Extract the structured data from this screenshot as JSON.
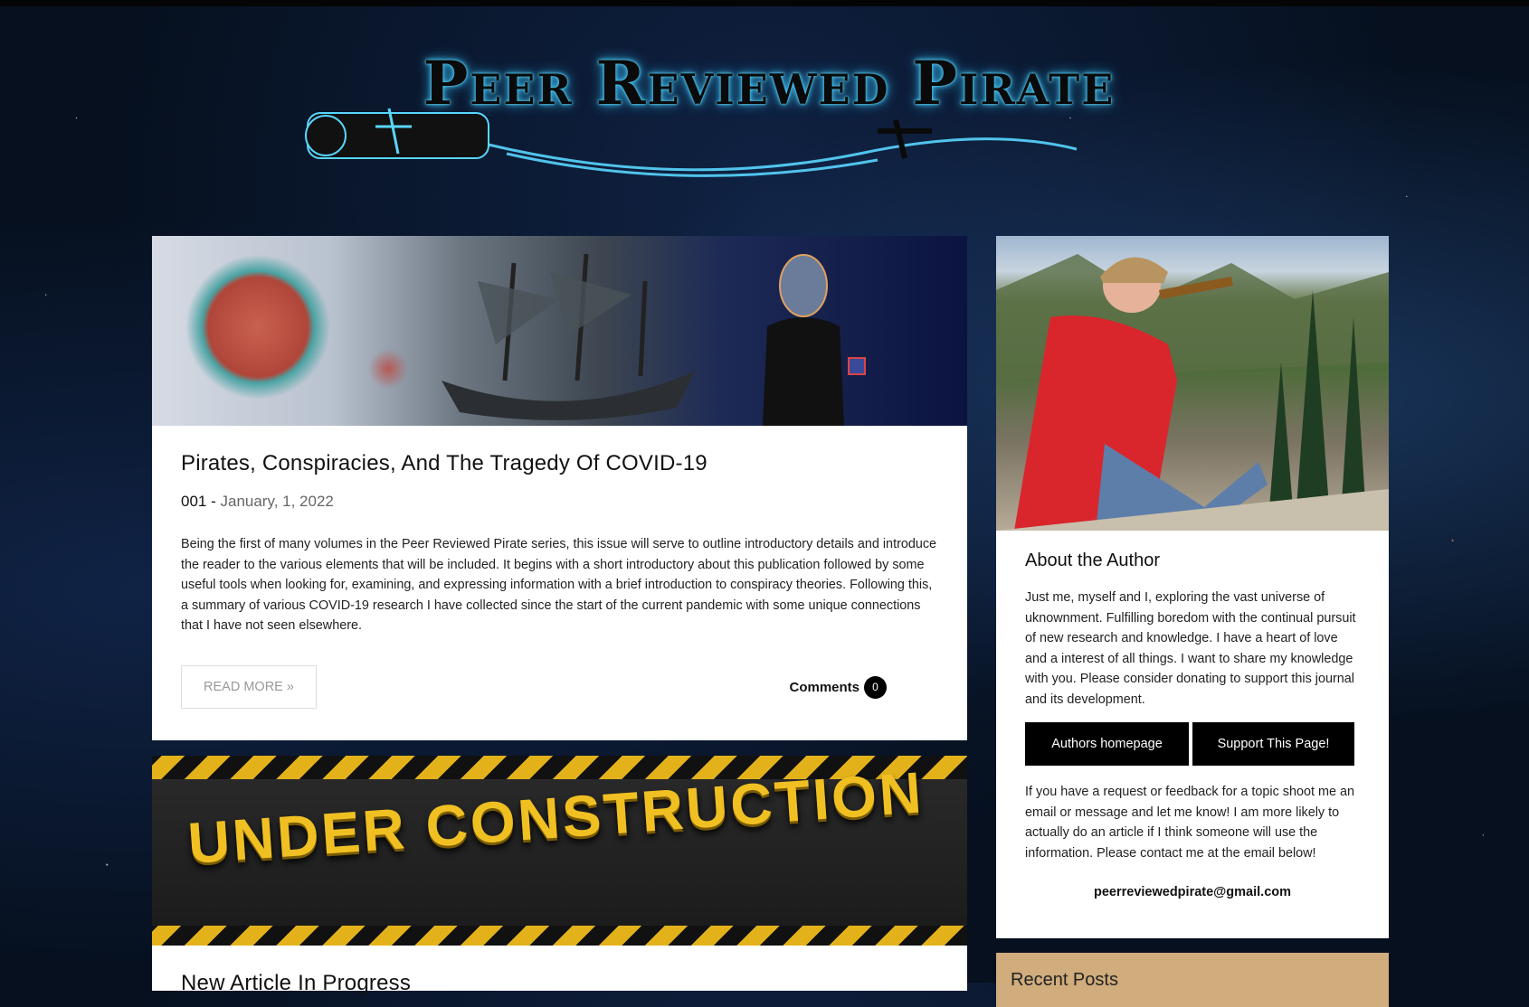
{
  "site": {
    "title": "Peer Reviewed Pirate"
  },
  "posts": [
    {
      "title": "Pirates, Conspiracies, And The Tragedy Of COVID-19",
      "issue": "001 -",
      "date": "January, 1, 2022",
      "excerpt": "Being the first of many volumes in the Peer Reviewed Pirate series, this issue will serve to outline introductory details and introduce the reader to the various elements that will be included. It begins with a short introductory about this publication followed by some useful tools when looking for, examining, and expressing information with a brief introduction to conspiracy theories. Following this, a summary of various COVID-19 research I have collected since the start of the current pandemic with some unique connections that I have not seen elsewhere.",
      "read_more": "READ MORE »",
      "comments_label": "Comments",
      "comments_count": "0"
    },
    {
      "image_text": "UNDER CONSTRUCTION",
      "title": "New Article In Progress"
    }
  ],
  "sidebar": {
    "about_title": "About the Author",
    "about_text": "Just me, myself and I, exploring the vast universe of uknownment. Fulfilling boredom with the continual pursuit of new research and knowledge. I have a heart of love and a interest of all things. I want to share my knowledge with you. Please consider donating to support this journal and its development.",
    "buttons": [
      "Authors homepage",
      "Support This Page!"
    ],
    "request_text": "If you have a request or feedback for a topic shoot me an email or message and let me know! I am more likely to actually do an article if I think someone will use the information. Please contact me at the email below!",
    "email": "peerreviewedpirate@gmail.com",
    "recent_title": "Recent Posts"
  },
  "colors": {
    "recent_bg": "#d1ac7c",
    "logo_glow": "#4fd2ff"
  }
}
